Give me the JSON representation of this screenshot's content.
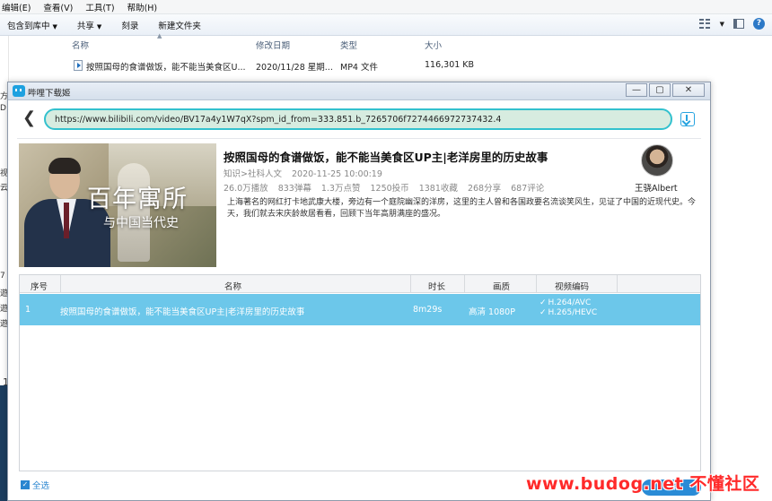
{
  "explorer": {
    "menu": [
      "编辑(E)",
      "查看(V)",
      "工具(T)",
      "帮助(H)"
    ],
    "toolbar": {
      "include_library": "包含到库中",
      "share": "共享",
      "burn": "刻录",
      "new_folder": "新建文件夹"
    },
    "columns": {
      "name": "名称",
      "modified": "修改日期",
      "type": "类型",
      "size": "大小"
    },
    "file": {
      "name": "按照国母的食谱做饭，能不能当美食区U...",
      "modified": "2020/11/28 星期...",
      "type": "MP4 文件",
      "size": "116,301 KB"
    },
    "left_fragments": [
      "方",
      "D",
      "视",
      "云",
      "7",
      "遊",
      "遊",
      "遊"
    ],
    "side_number": "1"
  },
  "downloader": {
    "window_title": "哔哩下载姬",
    "window_buttons": [
      "—",
      "▢",
      "✕"
    ],
    "url": "https://www.bilibili.com/video/BV17a4y1W7qX?spm_id_from=333.851.b_7265706f7274466972737432.4",
    "video": {
      "thumbnail_title": "百年寓所",
      "thumbnail_subtitle": "与中国当代史",
      "title": "按照国母的食谱做饭，能不能当美食区UP主|老洋房里的历史故事",
      "category": "知识>社科人文",
      "date": "2020-11-25 10:00:19",
      "stats": [
        "26.0万播放",
        "833弹幕",
        "1.3万点赞",
        "1250投币",
        "1381收藏",
        "268分享",
        "687评论"
      ],
      "description": "上海著名的网红打卡地武康大楼，旁边有一个庭院幽深的洋房，这里的主人曾和各国政要名流谈笑风生，见证了中国的近现代史。今天，我们就去宋庆龄故居看看，回顾下当年高朋满座的盛况。",
      "uploader": "王骁Albert"
    },
    "table": {
      "headers": {
        "index": "序号",
        "name": "名称",
        "duration": "时长",
        "quality": "画质",
        "codec": "视频编码"
      },
      "rows": [
        {
          "index": "1",
          "name": "按照国母的食谱做饭，能不能当美食区UP主|老洋房里的历史故事",
          "duration": "8m29s",
          "quality": "高清 1080P",
          "codecs": [
            "H.264/AVC",
            "H.265/HEVC"
          ]
        }
      ]
    },
    "select_all": "全选",
    "download_button": "下载"
  },
  "watermark": "www.budog.net 不懂社区"
}
